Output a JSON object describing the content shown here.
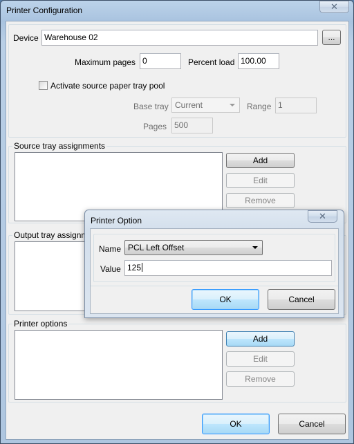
{
  "main_window": {
    "title": "Printer Configuration",
    "close_glyph": "✕",
    "device": {
      "label": "Device",
      "value": "Warehouse 02",
      "browse_label": "..."
    },
    "max_pages": {
      "label": "Maximum pages",
      "value": "0"
    },
    "percent_load": {
      "label": "Percent load",
      "value": "100.00"
    },
    "activate_pool": {
      "label": "Activate source paper tray pool",
      "checked": false
    },
    "base_tray": {
      "label": "Base tray",
      "value": "Current"
    },
    "range": {
      "label": "Range",
      "value": "1"
    },
    "pages": {
      "label": "Pages",
      "value": "500"
    },
    "source_trays": {
      "label": "Source tray assignments",
      "add": "Add",
      "edit": "Edit",
      "remove": "Remove"
    },
    "output_trays": {
      "label": "Output tray assignm"
    },
    "printer_options": {
      "label": "Printer options",
      "add": "Add",
      "edit": "Edit",
      "remove": "Remove"
    },
    "ok_label": "OK",
    "cancel_label": "Cancel"
  },
  "dialog": {
    "title": "Printer Option",
    "close_glyph": "✕",
    "name": {
      "label": "Name",
      "value": "PCL Left Offset"
    },
    "value": {
      "label": "Value",
      "value": "125"
    },
    "ok_label": "OK",
    "cancel_label": "Cancel"
  }
}
